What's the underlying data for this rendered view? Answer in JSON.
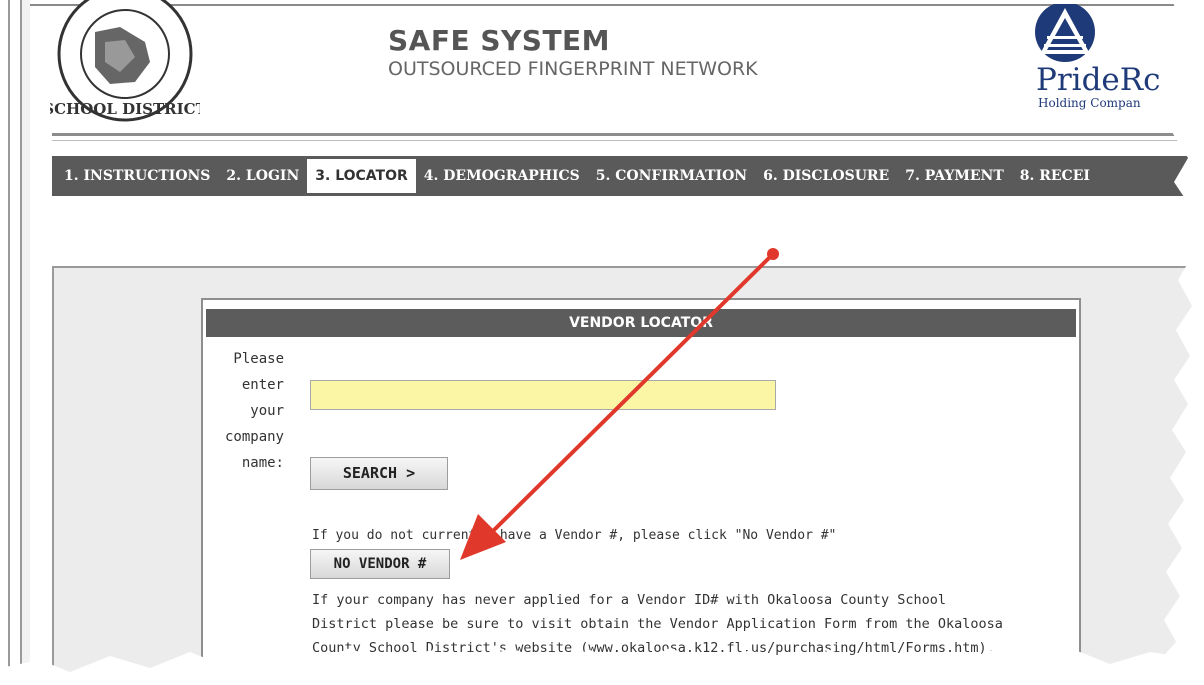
{
  "header": {
    "title": "SAFE SYSTEM",
    "subtitle": "OUTSOURCED FINGERPRINT NETWORK",
    "seal_label": "OKALOOSA COUNTY SCHOOL DISTRICT",
    "partner_name": "PrideRc",
    "partner_sub": "Holding Compan"
  },
  "nav": {
    "items": [
      {
        "label": "1. INSTRUCTIONS",
        "active": false
      },
      {
        "label": "2. LOGIN",
        "active": false
      },
      {
        "label": "3. LOCATOR",
        "active": true
      },
      {
        "label": "4. DEMOGRAPHICS",
        "active": false
      },
      {
        "label": "5. CONFIRMATION",
        "active": false
      },
      {
        "label": "6. DISCLOSURE",
        "active": false
      },
      {
        "label": "7. PAYMENT",
        "active": false
      },
      {
        "label": "8. RECEI",
        "active": false
      }
    ]
  },
  "locator": {
    "header": "VENDOR LOCATOR",
    "prompt_lines": [
      "Please",
      "enter your",
      "company",
      "name:"
    ],
    "company_input_value": "",
    "search_label": "SEARCH >",
    "no_vendor_note": "If you do not currently have a Vendor #, please click \"No Vendor #\"",
    "no_vendor_label": "NO VENDOR #",
    "info_lines": [
      "If your company has never applied for a Vendor ID# with Okaloosa County School",
      "District please be sure to visit obtain the Vendor Application Form from the Okaloosa",
      "County School District's website (www.okaloosa.k12.fl.us/purchasing/html/Forms.htm)."
    ]
  },
  "colors": {
    "nav_bg": "#5a5a5a",
    "input_bg": "#fbf6a6",
    "arrow": "#e0382a",
    "partner_blue": "#1f3a78"
  },
  "icons": [
    "school-seal-icon",
    "pride-triangle-icon",
    "annotation-arrow-icon"
  ]
}
